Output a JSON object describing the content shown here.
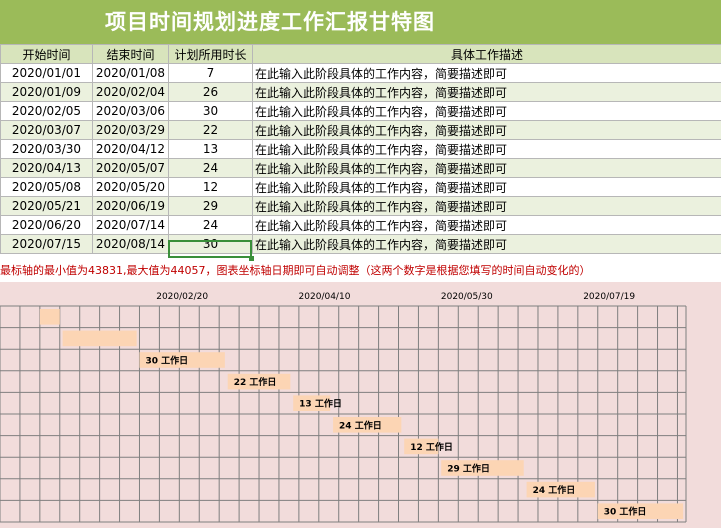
{
  "title": "项目时间规划进度工作汇报甘特图",
  "table": {
    "headers": [
      "开始时间",
      "结束时间",
      "计划所用时长",
      "具体工作描述"
    ],
    "rows": [
      [
        "2020/01/01",
        "2020/01/08",
        "7",
        "在此输入此阶段具体的工作内容，简要描述即可"
      ],
      [
        "2020/01/09",
        "2020/02/04",
        "26",
        "在此输入此阶段具体的工作内容，简要描述即可"
      ],
      [
        "2020/02/05",
        "2020/03/06",
        "30",
        "在此输入此阶段具体的工作内容，简要描述即可"
      ],
      [
        "2020/03/07",
        "2020/03/29",
        "22",
        "在此输入此阶段具体的工作内容，简要描述即可"
      ],
      [
        "2020/03/30",
        "2020/04/12",
        "13",
        "在此输入此阶段具体的工作内容，简要描述即可"
      ],
      [
        "2020/04/13",
        "2020/05/07",
        "24",
        "在此输入此阶段具体的工作内容，简要描述即可"
      ],
      [
        "2020/05/08",
        "2020/05/20",
        "12",
        "在此输入此阶段具体的工作内容，简要描述即可"
      ],
      [
        "2020/05/21",
        "2020/06/19",
        "29",
        "在此输入此阶段具体的工作内容，简要描述即可"
      ],
      [
        "2020/06/20",
        "2020/07/14",
        "24",
        "在此输入此阶段具体的工作内容，简要描述即可"
      ],
      [
        "2020/07/15",
        "2020/08/14",
        "30",
        "在此输入此阶段具体的工作内容，简要描述即可"
      ]
    ]
  },
  "note": "最标轴的最小值为43831,最大值为44057，图表坐标轴日期即可自动调整（这两个数字是根据您填写的时间自动变化的）",
  "chart_data": {
    "type": "bar",
    "orientation": "horizontal-gantt",
    "xlim": [
      "2020/01/01",
      "2020/08/14"
    ],
    "x_ticks": [
      "2020/02/20",
      "2020/04/10",
      "2020/05/30",
      "2020/07/19"
    ],
    "tasks": [
      {
        "start": "2020/01/01",
        "duration": 7,
        "label": ""
      },
      {
        "start": "2020/01/09",
        "duration": 26,
        "label": ""
      },
      {
        "start": "2020/02/05",
        "duration": 30,
        "label": "30 工作日"
      },
      {
        "start": "2020/03/07",
        "duration": 22,
        "label": "22 工作日"
      },
      {
        "start": "2020/03/30",
        "duration": 13,
        "label": "13 工作日"
      },
      {
        "start": "2020/04/13",
        "duration": 24,
        "label": "24 工作日"
      },
      {
        "start": "2020/05/08",
        "duration": 12,
        "label": "12 工作日"
      },
      {
        "start": "2020/05/21",
        "duration": 29,
        "label": "29 工作日"
      },
      {
        "start": "2020/06/20",
        "duration": 24,
        "label": "24 工作日"
      },
      {
        "start": "2020/07/15",
        "duration": 30,
        "label": "30 工作日"
      }
    ],
    "colors": {
      "background": "#f2dcdb",
      "bar": "#fcd5b4",
      "grid": "#7f7f7f",
      "label": "#000000"
    }
  }
}
